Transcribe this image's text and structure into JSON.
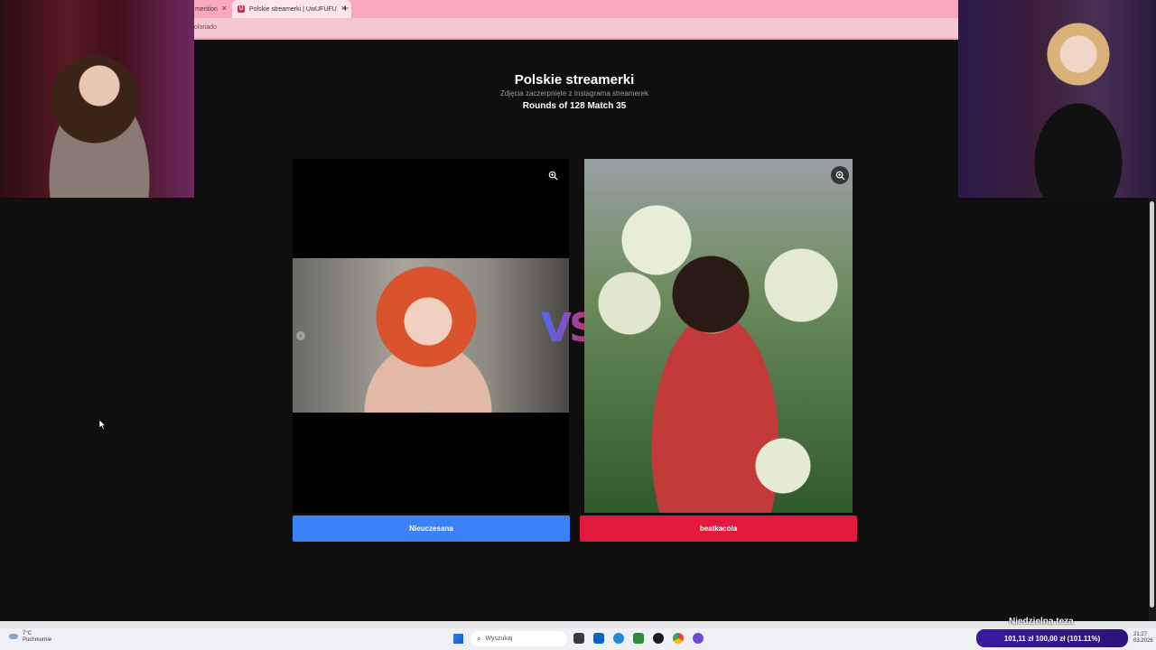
{
  "browser": {
    "prev_tab_label": "mention",
    "active_tab_label": "Polskie streamerki | UwUFUFU",
    "active_tab_favicon": "U",
    "address_text": "oloriado",
    "new_tab_symbol": "+"
  },
  "page": {
    "title": "Polskie streamerki",
    "subtitle": "Zdjęcia zaczerpnięte z Instagrama streamerek",
    "round_text": "Rounds of 128 Match 35",
    "vs_text": "VS",
    "left_choice": "Nieuczesana",
    "right_choice": "beatkacola"
  },
  "taskbar": {
    "weather_temp": "7°C",
    "weather_desc": "Pochmurnie",
    "search_placeholder": "Wyszukaj",
    "clock_time": "21:27",
    "clock_date": "03.2026"
  },
  "overlay": {
    "donation_text": "101,11 zł   100,00 zł (101.11%)",
    "banner_text": "Niedzielna teza"
  },
  "colors": {
    "left_choice": "#3b82f6",
    "right_choice": "#e2183d",
    "tabbar": "#f7a8bd"
  }
}
